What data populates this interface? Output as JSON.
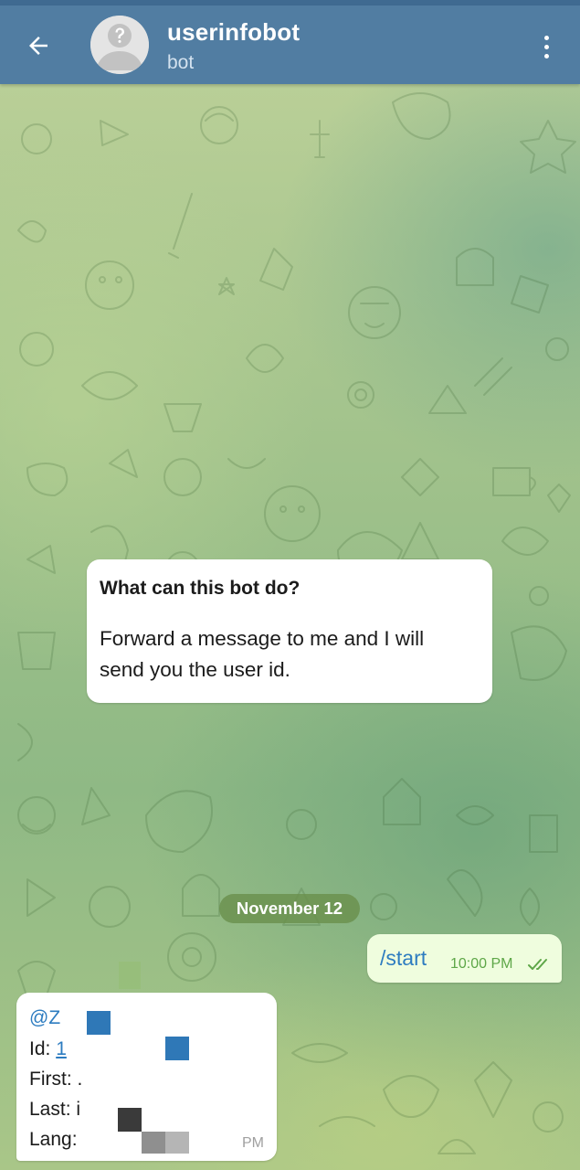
{
  "header": {
    "title": "userinfobot",
    "subtitle": "bot"
  },
  "icons": {
    "back": "arrow-left-icon",
    "menu": "more-vertical-icon",
    "avatar": "default-avatar-icon",
    "read_status": "double-check-icon"
  },
  "colors": {
    "header": "#517da2",
    "link": "#2d7cc0",
    "outgoing_bubble": "#effdde",
    "outgoing_time": "#5ea748",
    "date_pill": "#6a904d"
  },
  "messages": {
    "intro": {
      "title": "What can this bot do?",
      "line1": "Forward a message to me and I will",
      "line2": "send you the user id."
    },
    "date_separator": "November 12",
    "outgoing": {
      "text": "/start",
      "time": "10:00 PM"
    },
    "reply": {
      "username": "@Z",
      "id_label": "Id: ",
      "id_value": "1",
      "first_label": "First: .",
      "last_label": "Last: i",
      "lang_label": "Lang:",
      "time": "PM"
    }
  }
}
